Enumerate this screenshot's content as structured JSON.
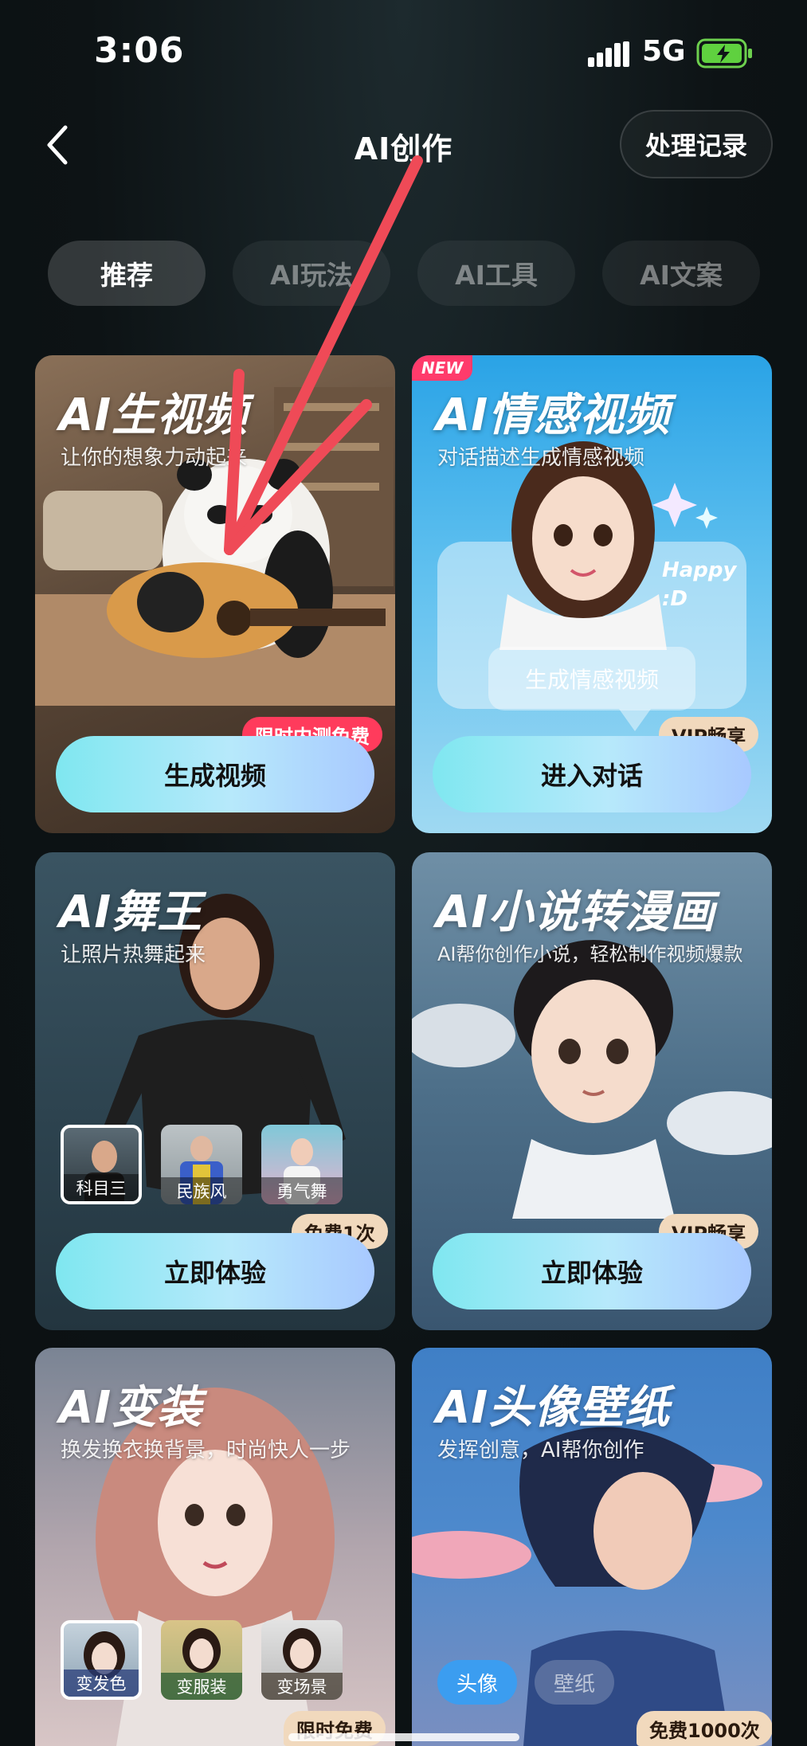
{
  "status_bar": {
    "time": "3:06",
    "network": "5G"
  },
  "header": {
    "title": "AI创作",
    "history_label": "处理记录"
  },
  "tabs": [
    {
      "label": "推荐",
      "active": true
    },
    {
      "label": "AI玩法",
      "active": false
    },
    {
      "label": "AI工具",
      "active": false
    },
    {
      "label": "AI文案",
      "active": false
    }
  ],
  "cards": [
    {
      "title": "AI生视频",
      "subtitle": "让你的想象力动起来",
      "cta": "生成视频",
      "badge": "限时内测免费"
    },
    {
      "title": "AI情感视频",
      "subtitle": "对话描述生成情感视频",
      "cta": "进入对话",
      "badge": "VIP畅享",
      "new_tag": "NEW",
      "bubble_text": "Happy :D",
      "inner_button": "生成情感视频"
    },
    {
      "title": "AI舞王",
      "subtitle": "让照片热舞起来",
      "cta": "立即体验",
      "badge": "免费1次",
      "styles": [
        "科目三",
        "民族风",
        "勇气舞"
      ]
    },
    {
      "title": "AI小说转漫画",
      "subtitle": "AI帮你创作小说，轻松制作视频爆款",
      "cta": "立即体验",
      "badge": "VIP畅享"
    },
    {
      "title": "AI变装",
      "subtitle": "换发换衣换背景，时尚快人一步",
      "badge": "限时免费",
      "styles": [
        "变发色",
        "变服装",
        "变场景"
      ]
    },
    {
      "title": "AI头像壁纸",
      "subtitle": "发挥创意，AI帮你创作",
      "badge": "免费1000次",
      "options": [
        "头像",
        "壁纸"
      ]
    }
  ],
  "colors": {
    "accent_red": "#ff3b5c",
    "vip_gold": "#f1d9bd",
    "cta_cyan": "#7fe7f0"
  }
}
